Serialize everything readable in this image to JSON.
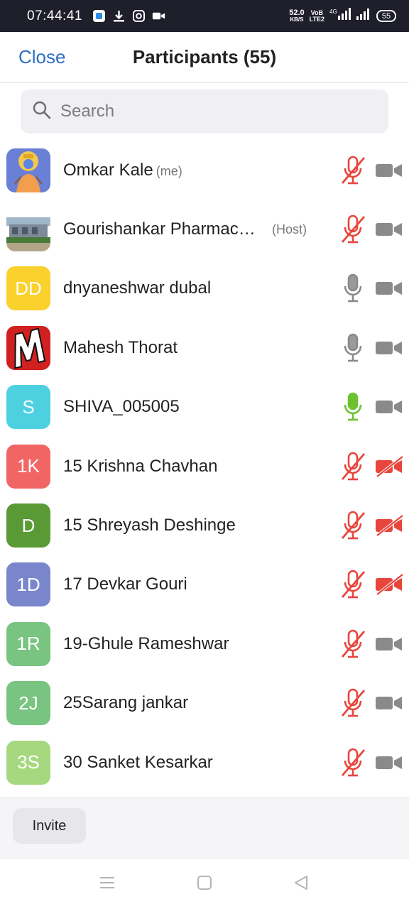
{
  "status_bar": {
    "time": "07:44:41",
    "net_speed": "52.0",
    "net_unit": "KB/S",
    "volte_top": "VoB",
    "volte_bottom": "LTE2",
    "network_type": "4G",
    "battery": "55"
  },
  "header": {
    "close_label": "Close",
    "title": "Participants (55)"
  },
  "search": {
    "placeholder": "Search",
    "value": ""
  },
  "participants": [
    {
      "name": "Omkar Kale",
      "tag": "(me)",
      "avatar_type": "photo-deity",
      "mic": "muted",
      "camera": "off-gray"
    },
    {
      "name": "Gourishankar Pharmac…",
      "tag": "(Host)",
      "avatar_type": "photo-building",
      "mic": "muted",
      "camera": "off-gray"
    },
    {
      "name": "dnyaneshwar dubal",
      "initials": "DD",
      "avatar_color": "#fbd12e",
      "mic": "unmuted",
      "camera": "off-gray"
    },
    {
      "name": "Mahesh Thorat",
      "avatar_type": "photo-logo-m",
      "mic": "unmuted",
      "camera": "off-gray"
    },
    {
      "name": "SHIVA_005005",
      "initials": "S",
      "avatar_color": "#4dd1e1",
      "mic": "speaking",
      "camera": "off-gray"
    },
    {
      "name": "15 Krishna Chavhan",
      "initials": "1K",
      "avatar_color": "#f26565",
      "mic": "muted",
      "camera": "off-red"
    },
    {
      "name": "15 Shreyash Deshinge",
      "initials": "D",
      "avatar_color": "#5a9a36",
      "mic": "muted",
      "camera": "off-red"
    },
    {
      "name": "17 Devkar Gouri",
      "initials": "1D",
      "avatar_color": "#7986cb",
      "mic": "muted",
      "camera": "off-red"
    },
    {
      "name": "19-Ghule Rameshwar",
      "initials": "1R",
      "avatar_color": "#79c480",
      "mic": "muted",
      "camera": "off-gray"
    },
    {
      "name": "25Sarang jankar",
      "initials": "2J",
      "avatar_color": "#79c480",
      "mic": "muted",
      "camera": "off-gray"
    },
    {
      "name": "30 Sanket Kesarkar",
      "initials": "3S",
      "avatar_color": "#a6d97f",
      "mic": "muted",
      "camera": "off-gray"
    }
  ],
  "footer": {
    "invite_label": "Invite"
  },
  "colors": {
    "accent": "#2d6fc6",
    "muted_red": "#e8453c",
    "speaking_green": "#6ac22f",
    "icon_gray": "#8a8a8a"
  },
  "nav": {
    "icons": [
      "menu-icon",
      "home-icon",
      "back-icon"
    ]
  }
}
